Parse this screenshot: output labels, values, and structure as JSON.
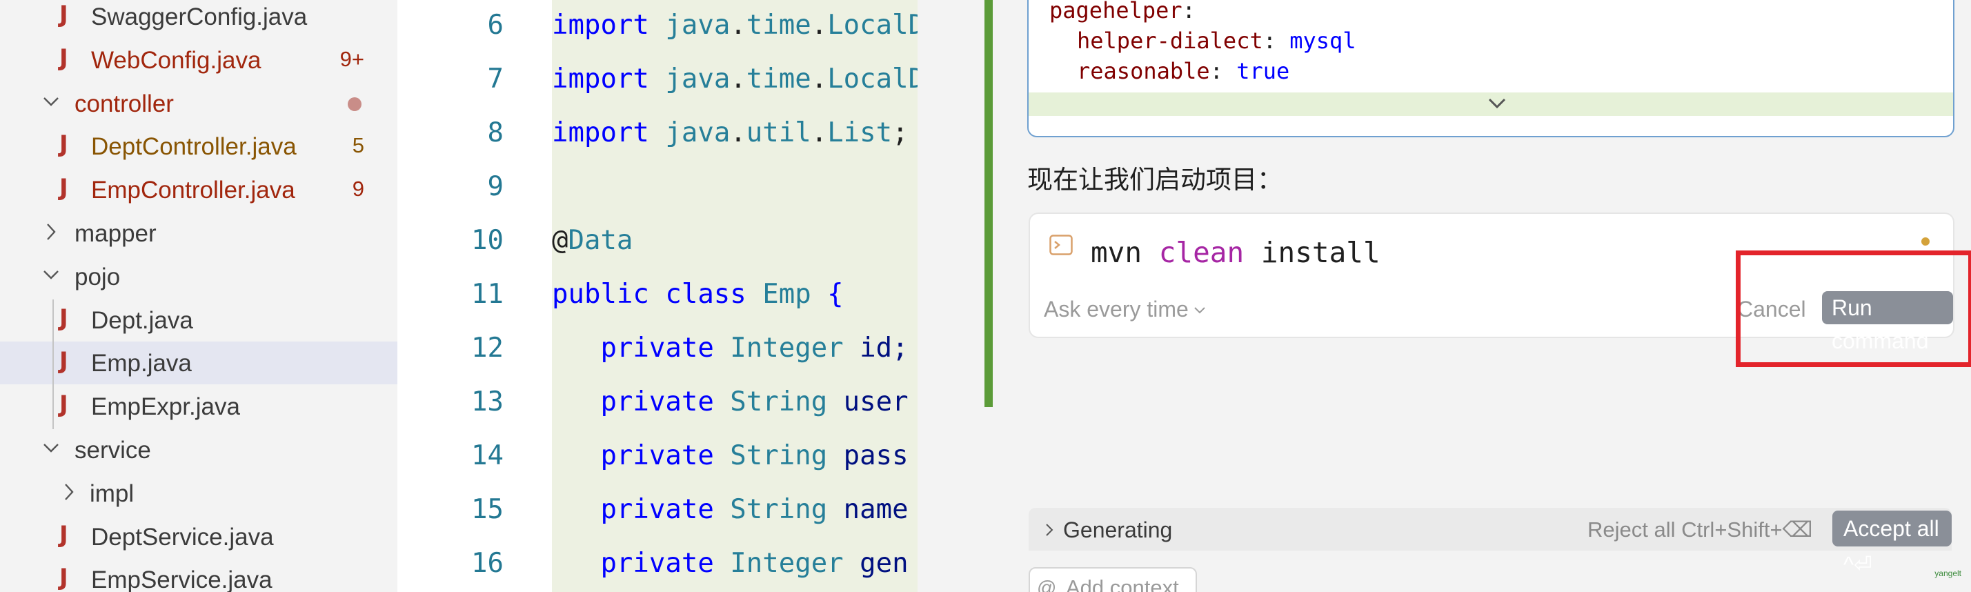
{
  "explorer": {
    "items": [
      {
        "label": "SwaggerConfig.java",
        "type": "file",
        "color": "#3b3b3b"
      },
      {
        "label": "WebConfig.java",
        "type": "file",
        "color": "#a1260d",
        "badge": "9+",
        "badge_color": "#a1260d"
      },
      {
        "label": "controller",
        "type": "folder-open",
        "color": "#a1260d"
      },
      {
        "label": "DeptController.java",
        "type": "file",
        "color": "#895503",
        "badge": "5",
        "badge_color": "#895503"
      },
      {
        "label": "EmpController.java",
        "type": "file",
        "color": "#a1260d",
        "badge": "9",
        "badge_color": "#a1260d"
      },
      {
        "label": "mapper",
        "type": "folder-closed",
        "color": "#3b3b3b"
      },
      {
        "label": "pojo",
        "type": "folder-open",
        "color": "#3b3b3b"
      },
      {
        "label": "Dept.java",
        "type": "file",
        "color": "#3b3b3b"
      },
      {
        "label": "Emp.java",
        "type": "file",
        "color": "#3b3b3b",
        "selected": true
      },
      {
        "label": "EmpExpr.java",
        "type": "file",
        "color": "#3b3b3b"
      },
      {
        "label": "service",
        "type": "folder-open",
        "color": "#3b3b3b"
      },
      {
        "label": "impl",
        "type": "folder-closed",
        "color": "#3b3b3b"
      },
      {
        "label": "DeptService.java",
        "type": "file",
        "color": "#3b3b3b"
      },
      {
        "label": "EmpService.java",
        "type": "file",
        "color": "#3b3b3b"
      }
    ]
  },
  "editor": {
    "lines": [
      {
        "n": "6",
        "tokens": [
          [
            "kw",
            "import "
          ],
          [
            "ty",
            "java"
          ],
          [
            "pl",
            "."
          ],
          [
            "ty",
            "time"
          ],
          [
            "pl",
            "."
          ],
          [
            "ty",
            "LocalD"
          ]
        ]
      },
      {
        "n": "7",
        "tokens": [
          [
            "kw",
            "import "
          ],
          [
            "ty",
            "java"
          ],
          [
            "pl",
            "."
          ],
          [
            "ty",
            "time"
          ],
          [
            "pl",
            "."
          ],
          [
            "ty",
            "LocalD"
          ]
        ]
      },
      {
        "n": "8",
        "tokens": [
          [
            "kw",
            "import "
          ],
          [
            "ty",
            "java"
          ],
          [
            "pl",
            "."
          ],
          [
            "ty",
            "util"
          ],
          [
            "pl",
            "."
          ],
          [
            "ty",
            "List"
          ],
          [
            "pl",
            ";"
          ]
        ]
      },
      {
        "n": "9",
        "tokens": []
      },
      {
        "n": "10",
        "tokens": [
          [
            "pl",
            "@"
          ],
          [
            "an",
            "Data"
          ]
        ]
      },
      {
        "n": "11",
        "tokens": [
          [
            "kw",
            "public class "
          ],
          [
            "ty",
            "Emp "
          ],
          [
            "kw",
            "{"
          ]
        ]
      },
      {
        "n": "12",
        "tokens": [
          [
            "pl",
            "   "
          ],
          [
            "kw",
            "private "
          ],
          [
            "ty",
            "Integer "
          ],
          [
            "id",
            "id;"
          ]
        ]
      },
      {
        "n": "13",
        "tokens": [
          [
            "pl",
            "   "
          ],
          [
            "kw",
            "private "
          ],
          [
            "ty",
            "String "
          ],
          [
            "id",
            "user"
          ]
        ]
      },
      {
        "n": "14",
        "tokens": [
          [
            "pl",
            "   "
          ],
          [
            "kw",
            "private "
          ],
          [
            "ty",
            "String "
          ],
          [
            "id",
            "pass"
          ]
        ]
      },
      {
        "n": "15",
        "tokens": [
          [
            "pl",
            "   "
          ],
          [
            "kw",
            "private "
          ],
          [
            "ty",
            "String "
          ],
          [
            "id",
            "name"
          ]
        ]
      },
      {
        "n": "16",
        "tokens": [
          [
            "pl",
            "   "
          ],
          [
            "kw",
            "private "
          ],
          [
            "ty",
            "Integer "
          ],
          [
            "id",
            "gen"
          ]
        ]
      }
    ]
  },
  "chat": {
    "yaml": {
      "line1_key": "pagehelper",
      "line1_colon": ":",
      "line2_key": "helper-dialect",
      "line2_val": "mysql",
      "line3_key": "reasonable",
      "line3_val": "true"
    },
    "intro_text": "现在让我们启动项目：",
    "command": {
      "cmd": "mvn",
      "arg": "clean",
      "rest": "install",
      "ask_mode": "Ask every time",
      "cancel_label": "Cancel",
      "run_label": "Run command",
      "highlight_color": "#e3242b"
    },
    "generating": {
      "label": "Generating",
      "reject_label": "Reject all Ctrl+Shift+⌫",
      "accept_label": "Accept all ^⏎"
    },
    "context": {
      "icon": "@",
      "label": "Add context"
    },
    "watermark": "yangelt"
  },
  "colors": {
    "accent_green": "#5b9b38",
    "keyword": "#0000ff",
    "type": "#267f99"
  }
}
